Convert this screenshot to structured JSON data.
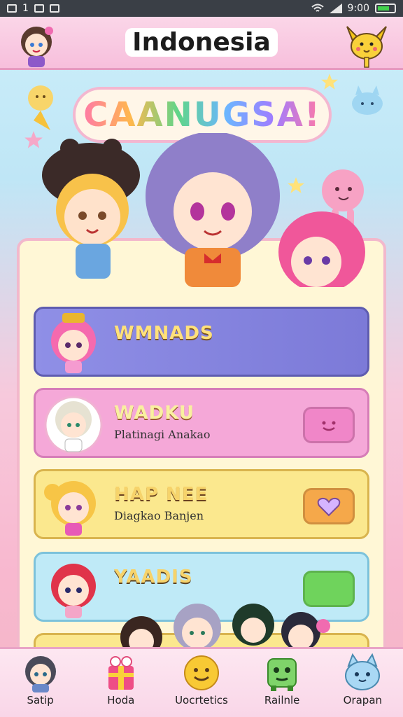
{
  "status_bar": {
    "left_text": "1",
    "time": "9:00"
  },
  "header": {
    "title": "Indonesia"
  },
  "banner": {
    "text": "CAANUGSA!"
  },
  "cards": [
    {
      "title": "WMNADS",
      "subtitle": ""
    },
    {
      "title": "WADKU",
      "subtitle": "Platinagi Anakao"
    },
    {
      "title": "HAP NEE",
      "subtitle": "Diagkao Banjen"
    },
    {
      "title": "YAADIS",
      "subtitle": ""
    }
  ],
  "nav": [
    {
      "label": "Satip",
      "icon": "avatar-icon"
    },
    {
      "label": "Hoda",
      "icon": "gift-box-icon"
    },
    {
      "label": "Uocrtetics",
      "icon": "smiley-face-icon"
    },
    {
      "label": "Railnle",
      "icon": "green-monster-icon"
    },
    {
      "label": "Orapan",
      "icon": "blue-cat-icon"
    }
  ],
  "colors": {
    "header_bg": "#f7bfdc",
    "card_blue": "#8f8fe6",
    "card_pink": "#f5a8d8",
    "card_yellow": "#fbe88e",
    "card_cyan": "#bfeaf7"
  }
}
